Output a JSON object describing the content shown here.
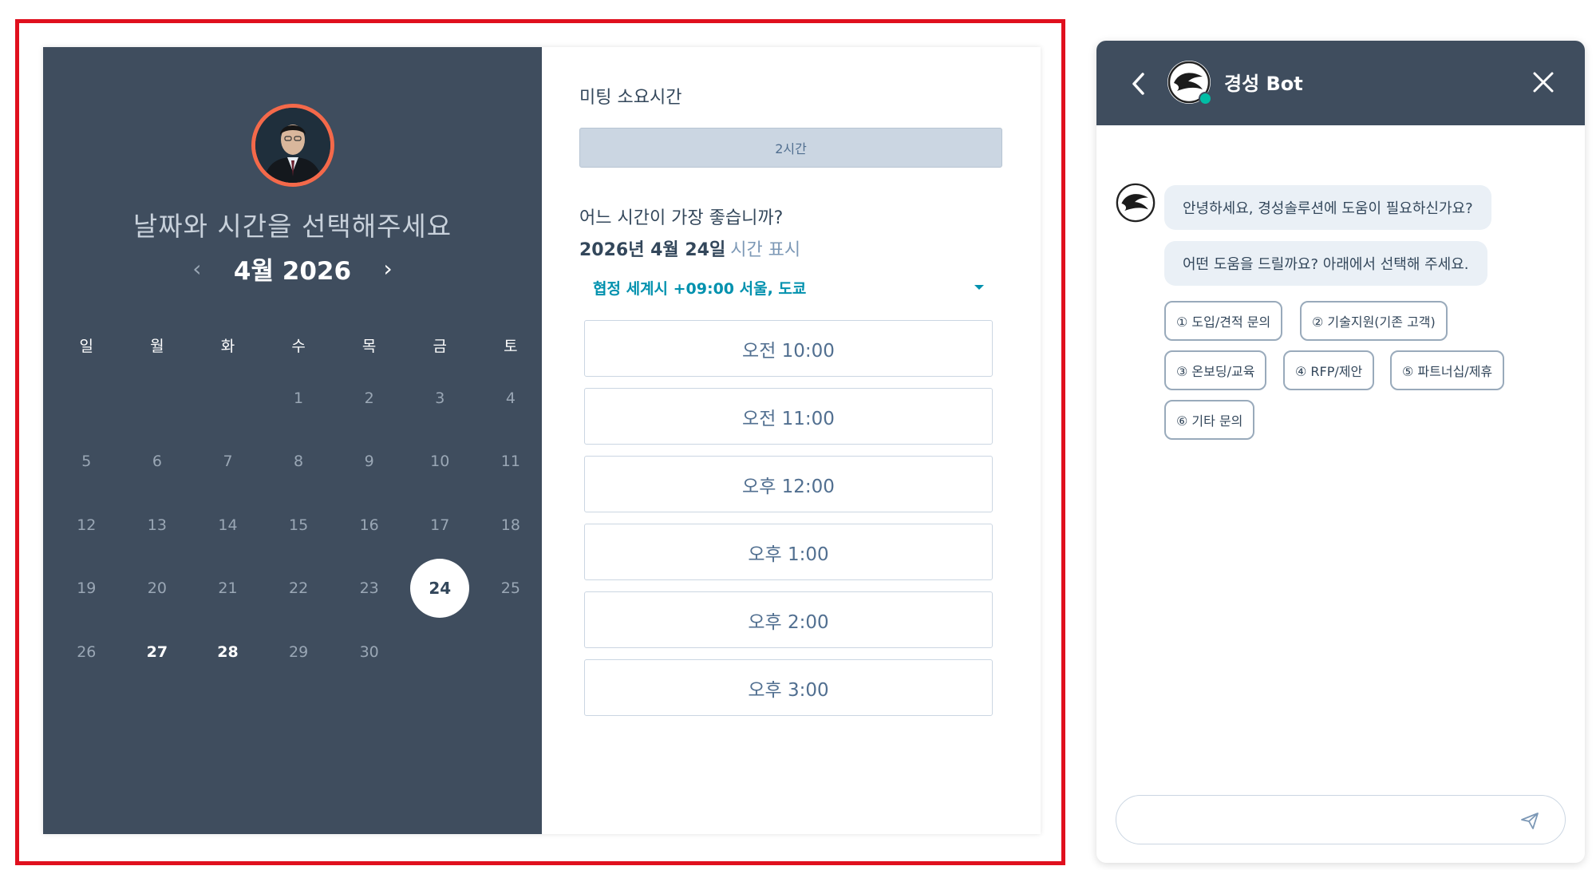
{
  "calendar": {
    "title": "날짜와 시간을 선택해주세요",
    "prev_icon": "‹",
    "next_icon": "›",
    "month_label": "4월 2026",
    "weekdays": [
      "일",
      "월",
      "화",
      "수",
      "목",
      "금",
      "토"
    ],
    "leading_blanks": 3,
    "days": [
      "1",
      "2",
      "3",
      "4",
      "5",
      "6",
      "7",
      "8",
      "9",
      "10",
      "11",
      "12",
      "13",
      "14",
      "15",
      "16",
      "17",
      "18",
      "19",
      "20",
      "21",
      "22",
      "23",
      "24",
      "25",
      "26",
      "27",
      "28",
      "29",
      "30"
    ],
    "available_days": [
      "24",
      "27",
      "28"
    ],
    "selected_day": "24"
  },
  "booking": {
    "duration_label": "미팅 소요시간",
    "duration_value": "2시간",
    "time_question": "어느 시간이 가장 좋습니까?",
    "date_bold": "2026년 4월 24일",
    "date_suffix": "시간 표시",
    "timezone": "협정 세계시 +09:00 서울, 도쿄",
    "slots": [
      "오전 10:00",
      "오전 11:00",
      "오후 12:00",
      "오후 1:00",
      "오후 2:00",
      "오후 3:00"
    ]
  },
  "chat": {
    "bot_name": "경성 Bot",
    "messages": [
      "안녕하세요, 경성솔루션에 도움이 필요하신가요?",
      "어떤 도움을 드릴까요? 아래에서 선택해 주세요."
    ],
    "options": [
      "① 도입/견적 문의",
      "② 기술지원(기존 고객)",
      "③ 온보딩/교육",
      "④ RFP/제안",
      "⑤ 파트너십/제휴",
      "⑥ 기타 문의"
    ],
    "input_placeholder": ""
  },
  "colors": {
    "highlight_frame": "#e0101e",
    "panel_dark": "#3f4d5e",
    "accent_teal": "#0091ae",
    "avatar_ring": "#f4694a",
    "online_status": "#00bda5"
  }
}
